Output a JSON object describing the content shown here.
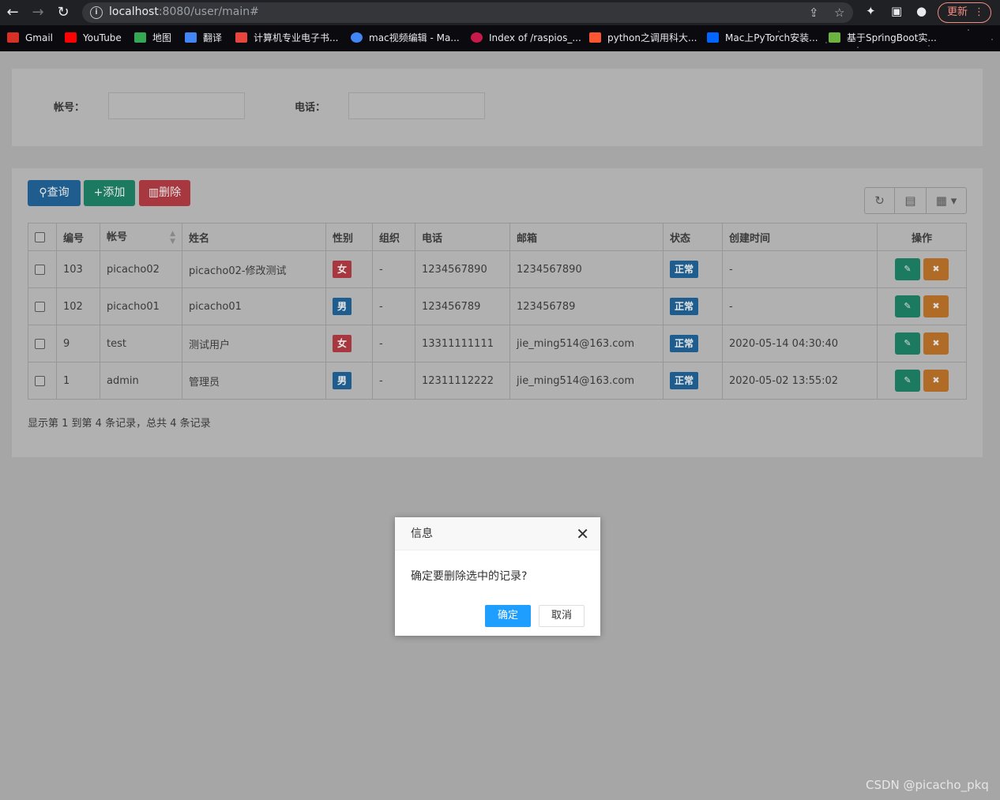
{
  "browser": {
    "url_host": "localhost",
    "url_rest": ":8080/user/main#",
    "update_label": "更新"
  },
  "bookmarks": [
    {
      "label": "Gmail",
      "color": "#d93025"
    },
    {
      "label": "YouTube",
      "color": "#ff0000"
    },
    {
      "label": "地图",
      "color": "#34a853"
    },
    {
      "label": "翻译",
      "color": "#4285f4"
    },
    {
      "label": "计算机专业电子书...",
      "color": "#e8453c"
    },
    {
      "label": "mac视频编辑 - Ma...",
      "color": "#4285f4"
    },
    {
      "label": "Index of /raspios_...",
      "color": "#c51a4a"
    },
    {
      "label": "python之调用科大...",
      "color": "#fc5531"
    },
    {
      "label": "Mac上PyTorch安装...",
      "color": "#0066ff"
    },
    {
      "label": "基于SpringBoot实...",
      "color": "#6db33f"
    }
  ],
  "search": {
    "account_label": "帐号：",
    "phone_label": "电话："
  },
  "toolbar": {
    "query": "查询",
    "add": "添加",
    "delete": "删除"
  },
  "table": {
    "headers": [
      "编号",
      "帐号",
      "姓名",
      "性别",
      "组织",
      "电话",
      "邮箱",
      "状态",
      "创建时间",
      "操作"
    ],
    "rows": [
      {
        "id": "103",
        "account": "picacho02",
        "name": "picacho02-修改测试",
        "gender": "女",
        "org": "-",
        "phone": "1234567890",
        "email": "1234567890",
        "status": "正常",
        "created": "-"
      },
      {
        "id": "102",
        "account": "picacho01",
        "name": "picacho01",
        "gender": "男",
        "org": "-",
        "phone": "123456789",
        "email": "123456789",
        "status": "正常",
        "created": "-"
      },
      {
        "id": "9",
        "account": "test",
        "name": "测试用户",
        "gender": "女",
        "org": "-",
        "phone": "13311111111",
        "email": "jie_ming514@163.com",
        "status": "正常",
        "created": "2020-05-14 04:30:40"
      },
      {
        "id": "1",
        "account": "admin",
        "name": "管理员",
        "gender": "男",
        "org": "-",
        "phone": "12311112222",
        "email": "jie_ming514@163.com",
        "status": "正常",
        "created": "2020-05-02 13:55:02"
      }
    ],
    "footer": "显示第 1 到第 4 条记录，总共 4 条记录"
  },
  "modal": {
    "title": "信息",
    "message": "确定要删除选中的记录?",
    "ok": "确定",
    "cancel": "取消"
  },
  "watermark": "CSDN @picacho_pkq"
}
